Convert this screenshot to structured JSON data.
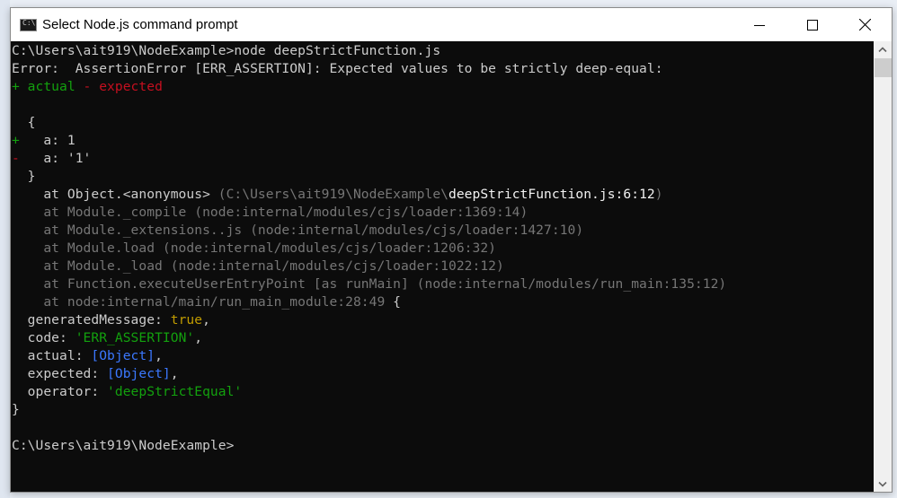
{
  "window": {
    "title": "Select Node.js command prompt",
    "icon": "console-app-icon",
    "controls": {
      "minimize": "minimize-icon",
      "maximize": "maximize-icon",
      "close": "close-icon"
    }
  },
  "colors": {
    "console_bg": "#0c0c0c",
    "default_text": "#cccccc",
    "green": "#13a10e",
    "red": "#c50f1f",
    "gray": "#767676",
    "yellow": "#c19c00",
    "blue": "#3b78ff"
  },
  "console": {
    "lines": [
      [
        {
          "t": "C:\\Users\\ait919\\NodeExample>node deepStrictFunction.js",
          "c": ""
        }
      ],
      [
        {
          "t": "Error:  AssertionError [ERR_ASSERTION]: Expected values to be strictly deep-equal:",
          "c": ""
        }
      ],
      [
        {
          "t": "+ actual",
          "c": "green"
        },
        {
          "t": " - expected",
          "c": "red"
        }
      ],
      [
        {
          "t": "",
          "c": ""
        }
      ],
      [
        {
          "t": "  {",
          "c": ""
        }
      ],
      [
        {
          "t": "+",
          "c": "green"
        },
        {
          "t": "   a: 1",
          "c": ""
        }
      ],
      [
        {
          "t": "-",
          "c": "red"
        },
        {
          "t": "   a: '1'",
          "c": ""
        }
      ],
      [
        {
          "t": "  }",
          "c": ""
        }
      ],
      [
        {
          "t": "    at Object.<anonymous> ",
          "c": ""
        },
        {
          "t": "(C:\\Users\\ait919\\NodeExample\\",
          "c": "gray"
        },
        {
          "t": "deepStrictFunction.js:6:12",
          "c": "white"
        },
        {
          "t": ")",
          "c": "gray"
        }
      ],
      [
        {
          "t": "    at Module._compile (node:internal/modules/cjs/loader:1369:14)",
          "c": "gray"
        }
      ],
      [
        {
          "t": "    at Module._extensions..js (node:internal/modules/cjs/loader:1427:10)",
          "c": "gray"
        }
      ],
      [
        {
          "t": "    at Module.load (node:internal/modules/cjs/loader:1206:32)",
          "c": "gray"
        }
      ],
      [
        {
          "t": "    at Module._load (node:internal/modules/cjs/loader:1022:12)",
          "c": "gray"
        }
      ],
      [
        {
          "t": "    at Function.executeUserEntryPoint [as runMain] (node:internal/modules/run_main:135:12)",
          "c": "gray"
        }
      ],
      [
        {
          "t": "    at node:internal/main/run_main_module:28:49",
          "c": "gray"
        },
        {
          "t": " {",
          "c": ""
        }
      ],
      [
        {
          "t": "  generatedMessage: ",
          "c": ""
        },
        {
          "t": "true",
          "c": "yellow"
        },
        {
          "t": ",",
          "c": ""
        }
      ],
      [
        {
          "t": "  code: ",
          "c": ""
        },
        {
          "t": "'ERR_ASSERTION'",
          "c": "green"
        },
        {
          "t": ",",
          "c": ""
        }
      ],
      [
        {
          "t": "  actual: ",
          "c": ""
        },
        {
          "t": "[Object]",
          "c": "blue"
        },
        {
          "t": ",",
          "c": ""
        }
      ],
      [
        {
          "t": "  expected: ",
          "c": ""
        },
        {
          "t": "[Object]",
          "c": "blue"
        },
        {
          "t": ",",
          "c": ""
        }
      ],
      [
        {
          "t": "  operator: ",
          "c": ""
        },
        {
          "t": "'deepStrictEqual'",
          "c": "green"
        }
      ],
      [
        {
          "t": "}",
          "c": ""
        }
      ],
      [
        {
          "t": "",
          "c": ""
        }
      ],
      [
        {
          "t": "C:\\Users\\ait919\\NodeExample>",
          "c": ""
        }
      ]
    ]
  },
  "scrollbar": {
    "up": "chevron-up-icon",
    "down": "chevron-down-icon"
  }
}
